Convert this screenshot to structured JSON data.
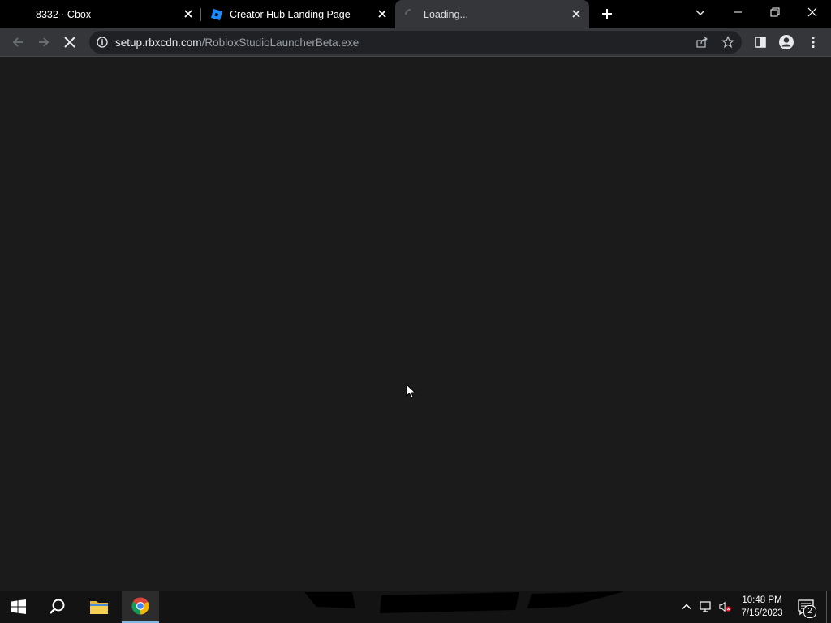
{
  "browser": {
    "tabs": [
      {
        "title": "8332 · Cbox",
        "active": false,
        "icon": "none"
      },
      {
        "title": "Creator Hub Landing Page",
        "active": false,
        "icon": "roblox-icon"
      },
      {
        "title": "Loading...",
        "active": true,
        "icon": "loading-spinner-icon"
      }
    ],
    "address": {
      "host": "setup.rbxcdn.com",
      "path": "/RobloxStudioLauncherBeta.exe"
    },
    "status": "loading"
  },
  "taskbar": {
    "pinned": [
      "windows-start-icon",
      "search-icon",
      "file-explorer-icon",
      "chrome-icon"
    ],
    "clock_time": "10:48 PM",
    "clock_date": "7/15/2023",
    "notification_count": "2"
  },
  "colors": {
    "page_bg": "#1b1b1b",
    "tab_strip": "#000000",
    "toolbar": "#35363a",
    "omnibox": "#202124",
    "taskbar": "#131313"
  }
}
